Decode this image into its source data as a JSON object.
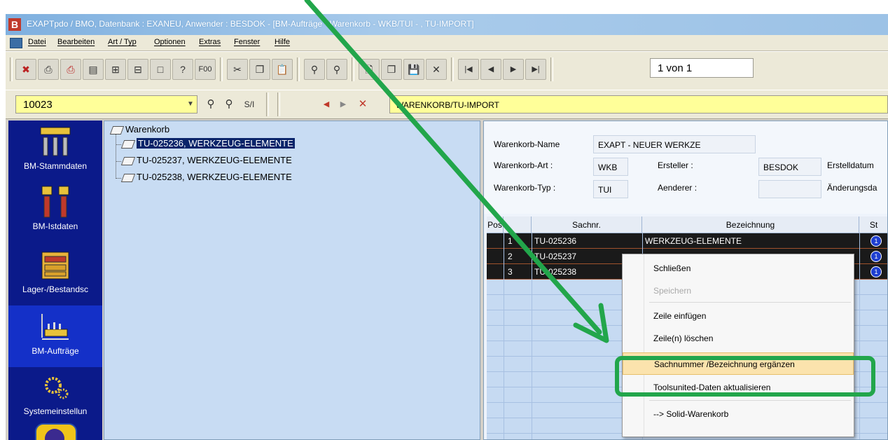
{
  "window": {
    "title": "EXAPTpdo / BMO, Datenbank : EXANEU, Anwender : BESDOK - [BM-Aufträge - Warenkorb - WKB/TUI - , TU-IMPORT]",
    "logo_letter": "B"
  },
  "menu": {
    "items": [
      "Datei",
      "Bearbeiten",
      "Art / Typ",
      "Optionen",
      "Extras",
      "Fenster",
      "Hilfe"
    ]
  },
  "toolbar": {
    "f00_label": "F00",
    "page_indicator": "1 von 1"
  },
  "toolbar2": {
    "number_value": "10023",
    "si_label": "S/I",
    "path_value": "WARENKORB/TU-IMPORT"
  },
  "nav": {
    "items": [
      "BM-Stammdaten",
      "BM-Istdaten",
      "Lager-/Bestandsc",
      "BM-Aufträge",
      "Systemeinstellun"
    ]
  },
  "tree": {
    "root": "Warenkorb",
    "children": [
      "TU-025236, WERKZEUG-ELEMENTE",
      "TU-025237, WERKZEUG-ELEMENTE",
      "TU-025238, WERKZEUG-ELEMENTE"
    ]
  },
  "header": {
    "name_label": "Warenkorb-Name",
    "name_value": "EXAPT - NEUER WERKZE",
    "art_label": "Warenkorb-Art :",
    "art_value": "WKB",
    "typ_label": "Warenkorb-Typ :",
    "typ_value": "TUI",
    "ersteller_label": "Ersteller :",
    "ersteller_value": "BESDOK",
    "aenderer_label": "Aenderer :",
    "erstelldatum_label": "Erstelldatum",
    "aenderungsdatum_label": "Änderungsda"
  },
  "grid": {
    "columns": [
      "Pos",
      "Sachnr.",
      "Bezeichnung",
      "St"
    ],
    "rows": [
      {
        "pos": "1",
        "sachnr": "TU-025236",
        "bezeichnung": "WERKZEUG-ELEMENTE"
      },
      {
        "pos": "2",
        "sachnr": "TU-025237",
        "bezeichnung": ""
      },
      {
        "pos": "3",
        "sachnr": "TU-025238",
        "bezeichnung": ""
      }
    ],
    "status_glyph": "1"
  },
  "context_menu": {
    "items": [
      "Schließen",
      "Speichern",
      "Zeile einfügen",
      "Zeile(n) löschen",
      "Sachnummer /Bezeichnung ergänzen",
      "Toolsunited-Daten aktualisieren",
      "--> Solid-Warenkorb"
    ]
  },
  "colors": {
    "annotation_green": "#22a64b",
    "nav_background": "#0b1a8a",
    "input_highlight": "#ffff99",
    "menu_hover": "#fbe3ad"
  }
}
